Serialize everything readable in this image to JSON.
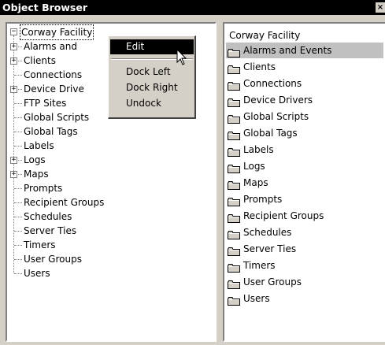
{
  "window": {
    "title": "Object Browser",
    "close_glyph": "×"
  },
  "tree": {
    "root": "Corway Facility",
    "items": [
      {
        "label": "Alarms and",
        "expandable": true
      },
      {
        "label": "Clients",
        "expandable": true
      },
      {
        "label": "Connections",
        "expandable": false
      },
      {
        "label": "Device Drive",
        "expandable": true
      },
      {
        "label": "FTP Sites",
        "expandable": false
      },
      {
        "label": "Global Scripts",
        "expandable": false
      },
      {
        "label": "Global Tags",
        "expandable": false
      },
      {
        "label": "Labels",
        "expandable": false
      },
      {
        "label": "Logs",
        "expandable": true
      },
      {
        "label": "Maps",
        "expandable": true
      },
      {
        "label": "Prompts",
        "expandable": false
      },
      {
        "label": "Recipient Groups",
        "expandable": false
      },
      {
        "label": "Schedules",
        "expandable": false
      },
      {
        "label": "Server Ties",
        "expandable": false
      },
      {
        "label": "Timers",
        "expandable": false
      },
      {
        "label": "User Groups",
        "expandable": false
      },
      {
        "label": "Users",
        "expandable": false
      }
    ]
  },
  "list": {
    "header": "Corway Facility",
    "items": [
      {
        "label": "Alarms and Events",
        "selected": true
      },
      {
        "label": "Clients",
        "selected": false
      },
      {
        "label": "Connections",
        "selected": false
      },
      {
        "label": "Device Drivers",
        "selected": false
      },
      {
        "label": "Global Scripts",
        "selected": false
      },
      {
        "label": "Global Tags",
        "selected": false
      },
      {
        "label": "Labels",
        "selected": false
      },
      {
        "label": "Logs",
        "selected": false
      },
      {
        "label": "Maps",
        "selected": false
      },
      {
        "label": "Prompts",
        "selected": false
      },
      {
        "label": "Recipient Groups",
        "selected": false
      },
      {
        "label": "Schedules",
        "selected": false
      },
      {
        "label": "Server Ties",
        "selected": false
      },
      {
        "label": "Timers",
        "selected": false
      },
      {
        "label": "User Groups",
        "selected": false
      },
      {
        "label": "Users",
        "selected": false
      }
    ]
  },
  "context_menu": {
    "edit": "Edit",
    "dock_left": "Dock Left",
    "dock_right": "Dock Right",
    "undock": "Undock"
  }
}
